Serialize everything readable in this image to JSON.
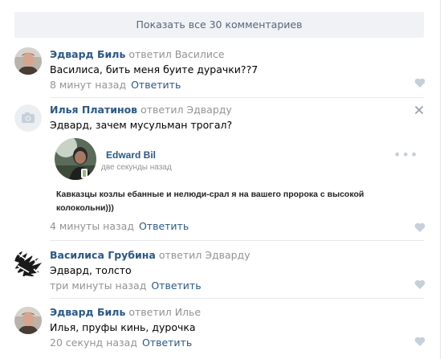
{
  "show_all_label": "Показать все 30 комментариев",
  "comments": [
    {
      "author": "Эдвард Биль",
      "replied": "ответил Василисе",
      "text": "Василиса, бить меня буите дурачки??7",
      "time": "8 минут назад",
      "reply": "Ответить"
    },
    {
      "author": "Илья Платинов",
      "replied": "ответил Эдварду",
      "text": "Эдвард, зачем мусульман трогал?",
      "time": "4 минуты назад",
      "reply": "Ответить",
      "attachment": {
        "name": "Edward Bil",
        "time": "две секунды назад",
        "dots": "•••",
        "text": "Кавказцы козлы ебанные и нелюди-срал я на вашего пророка с высокой колокольни)))"
      }
    },
    {
      "author": "Василиса Грубина",
      "replied": "ответил Эдварду",
      "text": "Эдвард, толсто",
      "time": "три минуты назад",
      "reply": "Ответить"
    },
    {
      "author": "Эдвард Биль",
      "replied": "ответил Илье",
      "text": "Илья, пруфы кинь, дурочка",
      "time": "20 секунд назад",
      "reply": "Ответить"
    }
  ],
  "colors": {
    "link": "#2a5885",
    "muted": "#939393",
    "button_bg": "#f0f2f5",
    "button_text": "#55677d",
    "separator": "#e7e8ec",
    "icon": "#c5d0db"
  },
  "icons": [
    "heart-icon",
    "close-icon",
    "camera-icon",
    "more-icon",
    "online-mobile-icon"
  ]
}
